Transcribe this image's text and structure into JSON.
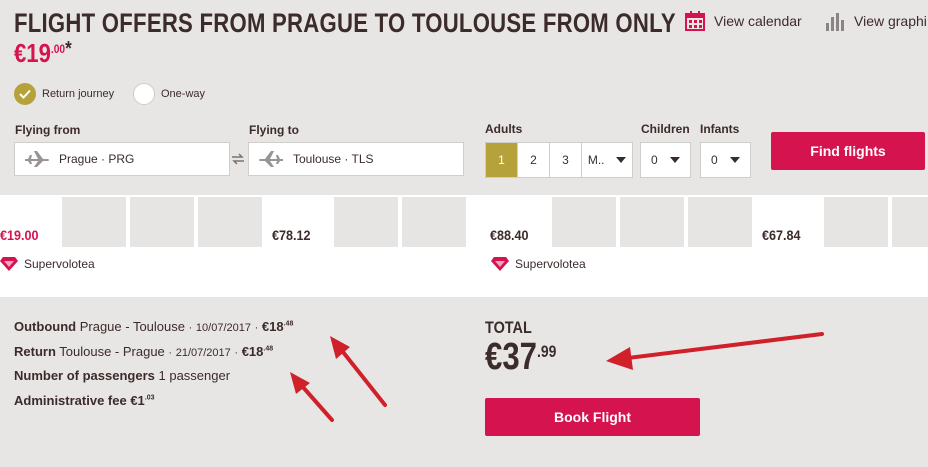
{
  "header": {
    "title": "FLIGHT OFFERS FROM PRAGUE TO TOULOUSE FROM ONLY",
    "price_main": "€19",
    "price_cents": ".00",
    "price_star": "*",
    "view_calendar": "View calendar",
    "view_graphic": "View graphi",
    "calendar_icon": "calendar-icon",
    "graphic_icon": "bar-chart-icon"
  },
  "journey": {
    "return_label": "Return journey",
    "oneway_label": "One-way",
    "selected": "return"
  },
  "form": {
    "from_label": "Flying from",
    "from_value": "Prague · PRG",
    "to_label": "Flying to",
    "to_value": "Toulouse · TLS",
    "adults_label": "Adults",
    "adults_options": [
      "1",
      "2",
      "3",
      "M.."
    ],
    "adults_selected": "1",
    "children_label": "Children",
    "children_value": "0",
    "infants_label": "Infants",
    "infants_value": "0",
    "find_label": "Find flights"
  },
  "calendar": {
    "outbound_prices": [
      "€19.00",
      "",
      "",
      "",
      "€78.12",
      "",
      ""
    ],
    "return_prices": [
      "€88.40",
      "",
      "",
      "",
      "€67.84",
      ""
    ],
    "super_label": "Supervolotea"
  },
  "summary": {
    "outbound_key": "Outbound",
    "outbound_route": "Prague - Toulouse",
    "outbound_date": "10/07/2017",
    "outbound_price": "€18",
    "outbound_cents": ".48",
    "return_key": "Return",
    "return_route": "Toulouse - Prague",
    "return_date": "21/07/2017",
    "return_price": "€18",
    "return_cents": ".48",
    "pax_key": "Number of passengers",
    "pax_value": "1 passenger",
    "fee_key": "Administrative fee",
    "fee_price": "€1",
    "fee_cents": ".03",
    "separator": "·"
  },
  "total": {
    "label": "TOTAL",
    "main": "€37",
    "cents": ".99",
    "book_label": "Book Flight"
  },
  "colors": {
    "brand_red": "#d5134f",
    "selected_gold": "#b6a23a",
    "annotation_arrow": "#d0202a"
  }
}
